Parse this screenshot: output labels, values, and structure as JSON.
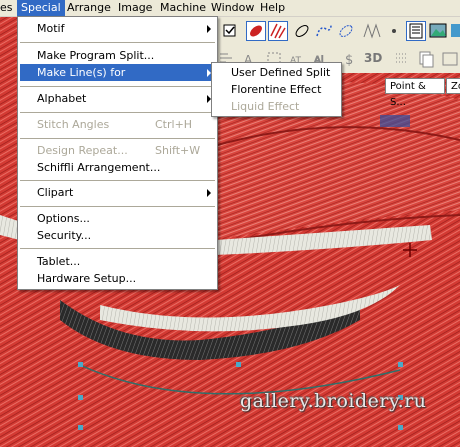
{
  "menubar": {
    "items": [
      {
        "label": "es",
        "active": false
      },
      {
        "label": "Special",
        "active": true
      },
      {
        "label": "Arrange",
        "active": false
      },
      {
        "label": "Image",
        "active": false
      },
      {
        "label": "Machine",
        "active": false
      },
      {
        "label": "Window",
        "active": false
      },
      {
        "label": "Help",
        "active": false
      }
    ]
  },
  "special_menu": {
    "items": [
      {
        "label": "Motif",
        "submenu": true,
        "enabled": true
      },
      {
        "label": "Make Program Split...",
        "enabled": true
      },
      {
        "label": "Make Line(s) for",
        "submenu": true,
        "enabled": true,
        "highlighted": true
      },
      {
        "label": "Alphabet",
        "submenu": true,
        "enabled": true
      },
      {
        "label": "Stitch Angles",
        "shortcut": "Ctrl+H",
        "enabled": false
      },
      {
        "label": "Design Repeat...",
        "shortcut": "Shift+W",
        "enabled": false
      },
      {
        "label": "Schiffli Arrangement...",
        "enabled": true
      },
      {
        "label": "Clipart",
        "submenu": true,
        "enabled": true
      },
      {
        "label": "Options...",
        "enabled": true
      },
      {
        "label": "Security...",
        "enabled": true
      },
      {
        "label": "Tablet...",
        "enabled": true
      },
      {
        "label": "Hardware Setup...",
        "enabled": true
      }
    ]
  },
  "submenu_make_lines": {
    "items": [
      {
        "label": "User Defined Split",
        "enabled": true
      },
      {
        "label": "Florentine Effect",
        "enabled": true
      },
      {
        "label": "Liquid Effect",
        "enabled": false
      }
    ]
  },
  "toolbar": {
    "tab_left": "Point & S...",
    "tab_right": "Zo",
    "label_3d": "3D"
  },
  "watermark": "gallery.broidery.ru",
  "colors": {
    "stitch_red": "#d8342e",
    "menu_highlight": "#316ac5",
    "menu_bg": "#ffffff",
    "toolbar_bg": "#ece9d8",
    "disabled_text": "#aca899"
  }
}
